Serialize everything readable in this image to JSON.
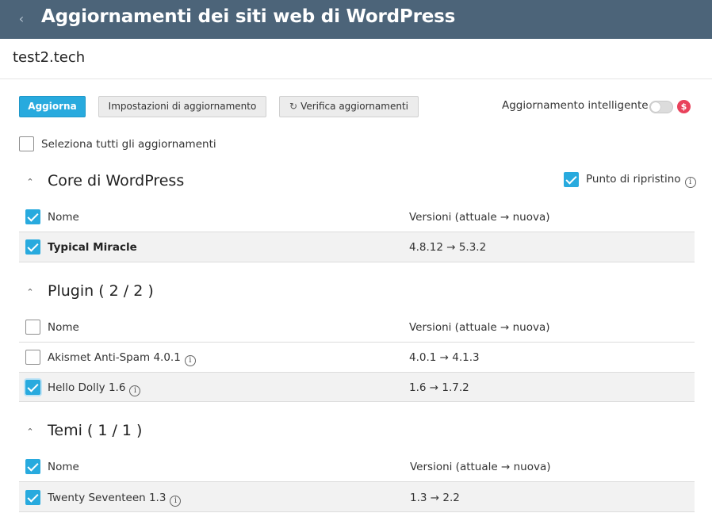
{
  "header": {
    "title": "Aggiornamenti dei siti web di WordPress",
    "back_icon": "chevron-left-icon"
  },
  "site": {
    "name": "test2.tech"
  },
  "toolbar": {
    "update_label": "Aggiorna",
    "settings_label": "Impostazioni di aggiornamento",
    "check_label": "Verifica aggiornamenti",
    "check_icon": "refresh-icon",
    "smart_update_label": "Aggiornamento intelligente",
    "smart_update_enabled": false,
    "paid_icon": "dollar-icon",
    "paid_symbol": "$"
  },
  "select_all": {
    "label": "Seleziona tutti gli aggiornamenti",
    "checked": false
  },
  "colors": {
    "header_bg": "#4c6479",
    "accent": "#28aade",
    "paid": "#e9425b"
  },
  "sections": {
    "core": {
      "title": "Core di WordPress",
      "restore_point_label": "Punto di ripristino",
      "restore_point_checked": true,
      "header": {
        "name": "Nome",
        "versions": "Versioni (attuale → nuova)",
        "checked": true
      },
      "rows": [
        {
          "name": "Typical Miracle",
          "versions": "4.8.12 → 5.3.2",
          "checked": true
        }
      ]
    },
    "plugins": {
      "title": "Plugin ( 2 / 2 )",
      "header": {
        "name": "Nome",
        "versions": "Versioni (attuale → nuova)",
        "checked": false
      },
      "rows": [
        {
          "name": "Akismet Anti-Spam 4.0.1",
          "versions": "4.0.1 → 4.1.3",
          "checked": false
        },
        {
          "name": "Hello Dolly 1.6",
          "versions": "1.6 → 1.7.2",
          "checked": true
        }
      ]
    },
    "themes": {
      "title": "Temi ( 1 / 1 )",
      "header": {
        "name": "Nome",
        "versions": "Versioni (attuale → nuova)",
        "checked": true
      },
      "rows": [
        {
          "name": "Twenty Seventeen 1.3",
          "versions": "1.3 → 2.2",
          "checked": true
        }
      ]
    }
  },
  "info_glyph": "i",
  "collapse_glyph": "⌃",
  "back_glyph": "‹",
  "refresh_glyph": "↻"
}
